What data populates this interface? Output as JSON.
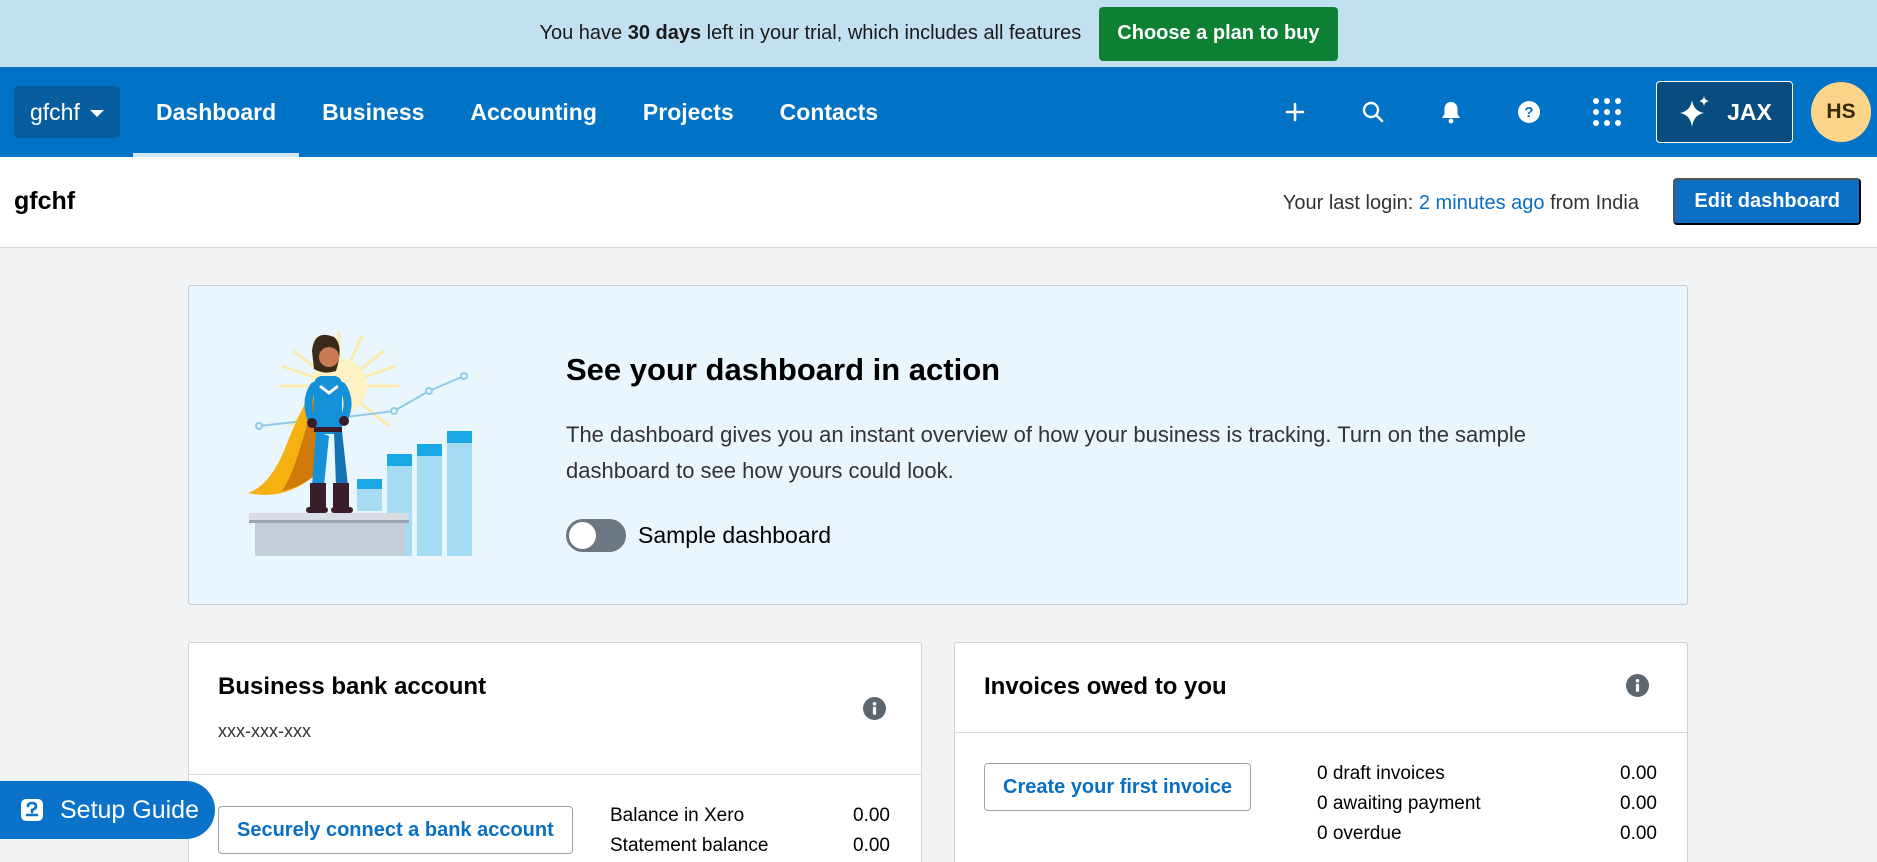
{
  "trial": {
    "text_before": "You have ",
    "days": "30 days",
    "text_after": " left in your trial, which includes all features",
    "cta": "Choose a plan to buy"
  },
  "nav": {
    "org": "gfchf",
    "tabs": [
      "Dashboard",
      "Business",
      "Accounting",
      "Projects",
      "Contacts"
    ],
    "active_tab": "Dashboard",
    "icons": [
      "plus-icon",
      "search-icon",
      "bell-icon",
      "help-icon",
      "app-grid-icon"
    ],
    "jax_label": "JAX",
    "avatar_initials": "HS"
  },
  "page_header": {
    "title": "gfchf",
    "last_login_prefix": "Your last login: ",
    "last_login_link": "2 minutes ago",
    "last_login_suffix": " from India",
    "edit_button": "Edit dashboard"
  },
  "promo": {
    "title": "See your dashboard in action",
    "description": "The dashboard gives you an instant overview of how your business is tracking. Turn on the sample dashboard to see how yours could look.",
    "toggle_label": "Sample dashboard",
    "toggle_on": false
  },
  "bank_card": {
    "title": "Business bank account",
    "account_number": "xxx-xxx-xxx",
    "button": "Securely connect a bank account",
    "stats": [
      {
        "label": "Balance in Xero",
        "value": "0.00"
      },
      {
        "label": "Statement balance",
        "value": "0.00"
      }
    ]
  },
  "invoices_card": {
    "title": "Invoices owed to you",
    "button": "Create your first invoice",
    "stats": [
      {
        "label": "0 draft invoices",
        "value": "0.00"
      },
      {
        "label": "0 awaiting payment",
        "value": "0.00"
      },
      {
        "label": "0 overdue",
        "value": "0.00"
      }
    ]
  },
  "setup_guide": {
    "label": "Setup Guide"
  },
  "colors": {
    "banner_bg": "#c3e0f0",
    "cta_green": "#0e8034",
    "nav_blue": "#0173c6",
    "link_blue": "#0a6fc2",
    "avatar_bg": "#fcd58a"
  }
}
